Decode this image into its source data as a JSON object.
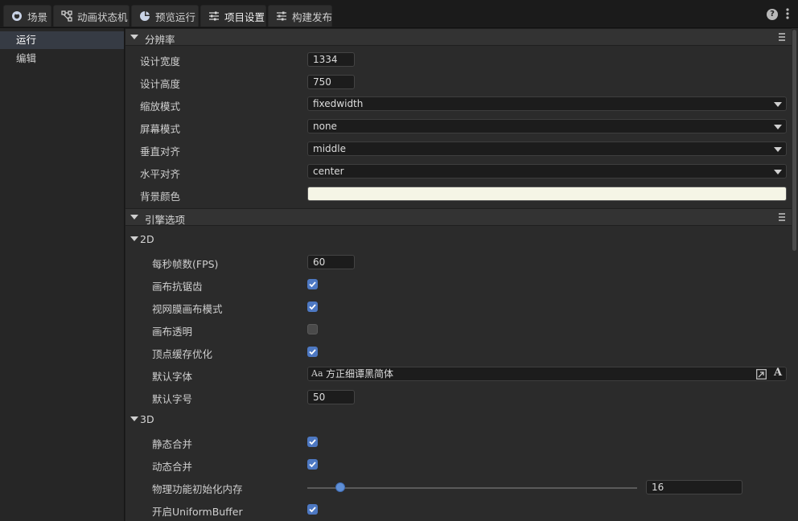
{
  "tabs": [
    {
      "label": "场景",
      "icon": "scene-icon",
      "active": false
    },
    {
      "label": "动画状态机",
      "icon": "state-machine-icon",
      "active": false
    },
    {
      "label": "预览运行",
      "icon": "preview-icon",
      "active": false
    },
    {
      "label": "项目设置",
      "icon": "settings-sliders-icon",
      "active": true
    },
    {
      "label": "构建发布",
      "icon": "build-sliders-icon",
      "active": false
    }
  ],
  "topbar": {
    "help": "?"
  },
  "sidebar": {
    "items": [
      {
        "label": "运行",
        "active": true
      },
      {
        "label": "编辑",
        "active": false
      }
    ]
  },
  "resolution": {
    "title": "分辨率",
    "design_width": {
      "label": "设计宽度",
      "value": "1334"
    },
    "design_height": {
      "label": "设计高度",
      "value": "750"
    },
    "scale_mode": {
      "label": "缩放模式",
      "value": "fixedwidth"
    },
    "screen_mode": {
      "label": "屏幕模式",
      "value": "none"
    },
    "valign": {
      "label": "垂直对齐",
      "value": "middle"
    },
    "halign": {
      "label": "水平对齐",
      "value": "center"
    },
    "bg_color": {
      "label": "背景颜色",
      "value": "#f5f5e6"
    }
  },
  "engine": {
    "title": "引擎选项",
    "d2": {
      "title": "2D",
      "fps": {
        "label": "每秒帧数(FPS)",
        "value": "60"
      },
      "antialias": {
        "label": "画布抗锯齿",
        "checked": true
      },
      "retina": {
        "label": "视网膜画布模式",
        "checked": true
      },
      "transparent": {
        "label": "画布透明",
        "checked": false
      },
      "vertex_cache": {
        "label": "顶点缓存优化",
        "checked": true
      },
      "default_font": {
        "label": "默认字体",
        "value": "方正细谭黑简体",
        "prefix": "Aa",
        "font_icon": "A"
      },
      "font_size": {
        "label": "默认字号",
        "value": "50"
      }
    },
    "d3": {
      "title": "3D",
      "static_batch": {
        "label": "静态合并",
        "checked": true
      },
      "dynamic_batch": {
        "label": "动态合并",
        "checked": true
      },
      "physics_memory": {
        "label": "物理功能初始化内存",
        "value": "16",
        "fraction": 0.1
      },
      "uniform_buffer": {
        "label": "开启UniformBuffer",
        "checked": true
      }
    }
  },
  "colors": {
    "accent": "#4d78c2",
    "active_tab": "#2c2c2c",
    "sidebar_active": "#363b44"
  }
}
